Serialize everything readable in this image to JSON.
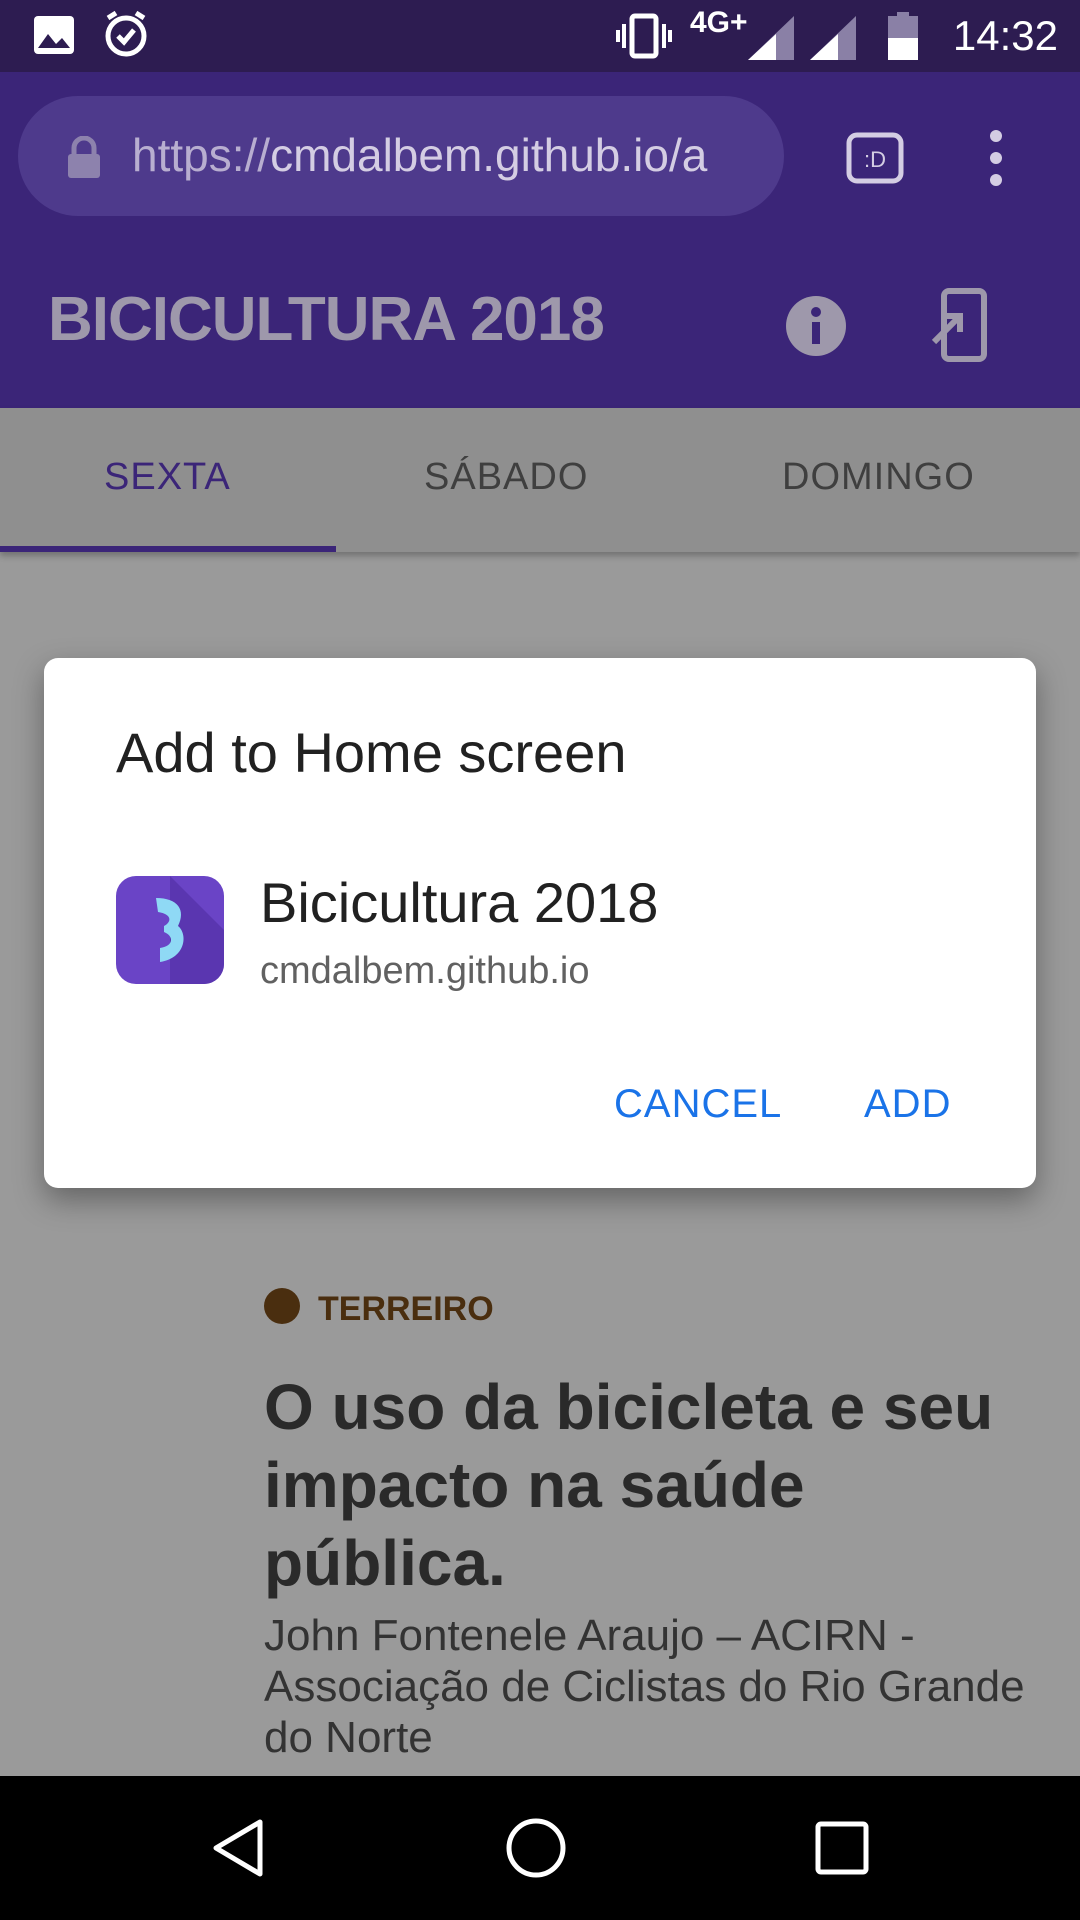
{
  "status_bar": {
    "network": "4G+",
    "time": "14:32",
    "icons": [
      "image-icon",
      "alarm-icon",
      "vibrate-icon",
      "signal-icon",
      "signal-icon-2",
      "battery-icon"
    ]
  },
  "browser": {
    "url_scheme": "https://",
    "url_host": "cmdalbem.github.io/a",
    "icons": [
      "lock-icon",
      "tab-switcher-icon",
      "overflow-menu-icon"
    ]
  },
  "app_bar": {
    "title": "BICICULTURA 2018",
    "icons": [
      "info-icon",
      "install-icon"
    ]
  },
  "tabs": [
    {
      "label": "SEXTA",
      "active": true
    },
    {
      "label": "SÁBADO",
      "active": false
    },
    {
      "label": "DOMINGO",
      "active": false
    }
  ],
  "dialog": {
    "title": "Add to Home screen",
    "app_name": "Bicicultura 2018",
    "app_url": "cmdalbem.github.io",
    "cancel_label": "CANCEL",
    "add_label": "ADD"
  },
  "content": {
    "category": "TERREIRO",
    "category_color": "#4a2e0f",
    "title": "O uso da bicicleta e seu impacto na saúde pública.",
    "subtitle": "John Fontenele Araujo – ACIRN - Associação de Ciclistas do Rio Grande do Norte"
  },
  "nav_bar": {
    "icons": [
      "back-icon",
      "home-icon",
      "recents-icon"
    ]
  },
  "colors": {
    "brand": "#3b2578",
    "accent_button": "#1a73e8",
    "app_icon": "#6a44c6"
  }
}
